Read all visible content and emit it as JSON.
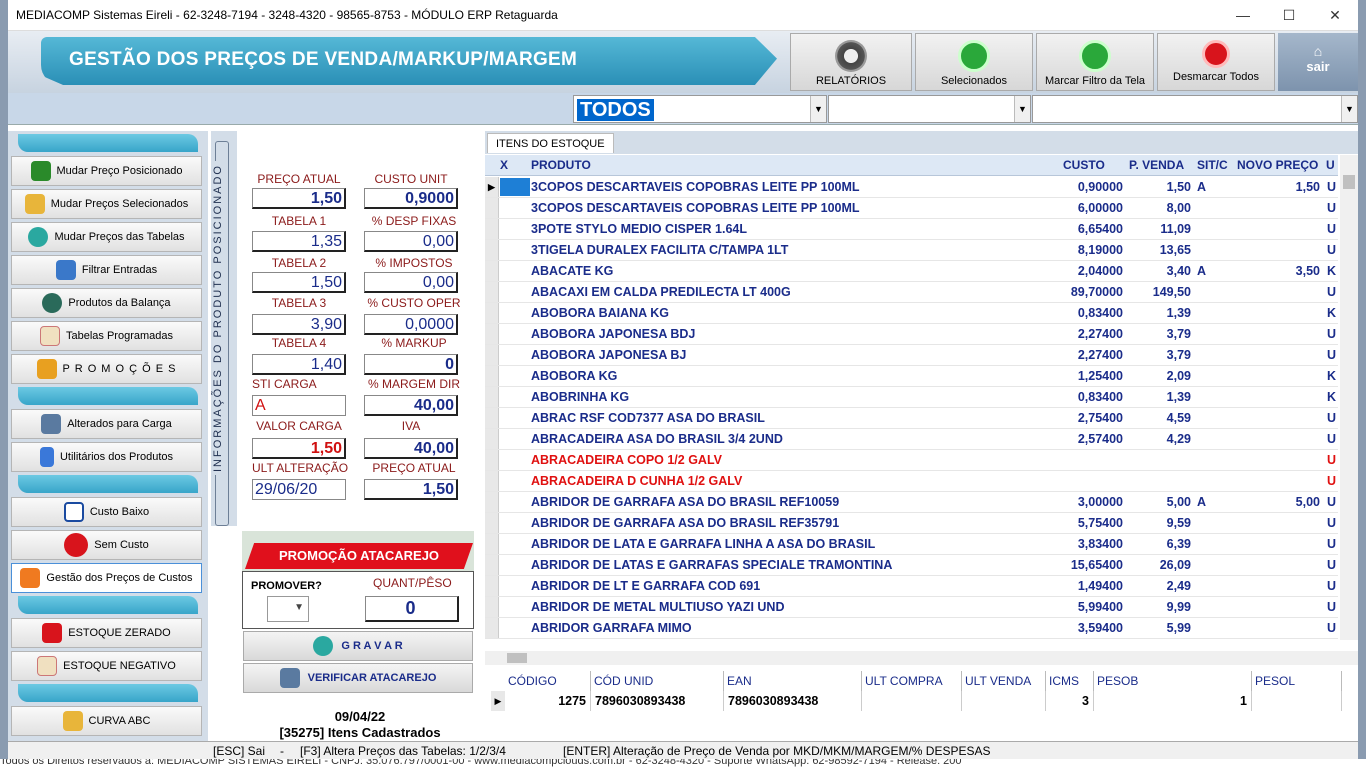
{
  "window_title": "MEDIACOMP Sistemas Eireli - 62-3248-7194 - 3248-4320 - 98565-8753 - MÓDULO ERP Retaguarda",
  "window_controls": {
    "minimize": "—",
    "maximize": "☐",
    "close": "✕"
  },
  "banner_title": "GESTÃO DOS PREÇOS DE VENDA/MARKUP/MARGEM",
  "toolbar": {
    "relatorios": "RELATÓRIOS",
    "selecionados": "Selecionados",
    "marcar": "Marcar Filtro da Tela",
    "desmarcar": "Desmarcar Todos",
    "sair": "sair",
    "sair_icon": "⌂"
  },
  "filter": {
    "todos": "TODOS",
    "arrow": "▼"
  },
  "nav": [
    "Mudar Preço Posicionado",
    "Mudar Preços Selecionados",
    "Mudar Preços das Tabelas",
    "Filtrar Entradas",
    "Produtos da Balança",
    "Tabelas Programadas",
    "P R O M O Ç Õ E S",
    "Alterados para Carga",
    "Utilitários dos Produtos",
    "Custo Baixo",
    "Sem Custo",
    "Gestão dos Preços de Custos",
    "ESTOQUE ZERADO",
    "ESTOQUE NEGATIVO",
    "CURVA ABC"
  ],
  "vertical_label": "INFORMAÇÕES DO PRODUTO POSICIONADO",
  "info": {
    "preco_atual_lbl": "PREÇO ATUAL",
    "preco_atual": "1,50",
    "custo_unit_lbl": "CUSTO UNIT",
    "custo_unit": "0,9000",
    "tabela1_lbl": "TABELA 1",
    "tabela1": "1,35",
    "desp_fixas_lbl": "% DESP FIXAS",
    "desp_fixas": "0,00",
    "tabela2_lbl": "TABELA 2",
    "tabela2": "1,50",
    "impostos_lbl": "% IMPOSTOS",
    "impostos": "0,00",
    "tabela3_lbl": "TABELA 3",
    "tabela3": "3,90",
    "custo_oper_lbl": "% CUSTO OPER",
    "custo_oper": "0,0000",
    "tabela4_lbl": "TABELA 4",
    "tabela4": "1,40",
    "markup_lbl": "% MARKUP",
    "markup": "0",
    "sti_carga_lbl": "STI CARGA",
    "sti_carga": "A",
    "margem_dir_lbl": "% MARGEM DIR",
    "margem_dir": "40,00",
    "valor_carga_lbl": "VALOR CARGA",
    "valor_carga": "1,50",
    "iva_lbl": "IVA",
    "iva": "40,00",
    "ult_alteracao_lbl": "ULT ALTERAÇÃO",
    "ult_alteracao": "29/06/20",
    "preco_atual2_lbl": "PREÇO ATUAL",
    "preco_atual2": "1,50"
  },
  "promo": {
    "title": "PROMOÇÃO ATACAREJO",
    "promover_lbl": "PROMOVER?",
    "quant_lbl": "QUANT/PÊSO",
    "quant": "0",
    "gravar": "G R A V A R",
    "verificar": "VERIFICAR ATACAREJO"
  },
  "summary": {
    "date": "09/04/22",
    "count": "[35275] Itens Cadastrados"
  },
  "grid": {
    "tab": "ITENS DO ESTOQUE",
    "headers": {
      "x": "X",
      "produto": "PRODUTO",
      "custo": "CUSTO",
      "pvenda": "P. VENDA",
      "sitc": "SIT/C",
      "novo": "NOVO PREÇO",
      "u": "U"
    },
    "rows": [
      {
        "produto": "3COPOS DESCARTAVEIS COPOBRAS LEITE  PP 100ML",
        "custo": "0,90000",
        "pvenda": "1,50",
        "sitc": "A",
        "novo": "1,50",
        "u": "U"
      },
      {
        "produto": "3COPOS DESCARTAVEIS COPOBRAS LEITE  PP 100ML",
        "custo": "6,00000",
        "pvenda": "8,00",
        "sitc": "",
        "novo": "",
        "u": "U"
      },
      {
        "produto": "3POTE STYLO MEDIO CISPER 1.64L",
        "custo": "6,65400",
        "pvenda": "11,09",
        "sitc": "",
        "novo": "",
        "u": "U"
      },
      {
        "produto": "3TIGELA DURALEX FACILITA C/TAMPA 1LT",
        "custo": "8,19000",
        "pvenda": "13,65",
        "sitc": "",
        "novo": "",
        "u": "U"
      },
      {
        "produto": "ABACATE KG",
        "custo": "2,04000",
        "pvenda": "3,40",
        "sitc": "A",
        "novo": "3,50",
        "u": "K"
      },
      {
        "produto": "ABACAXI EM CALDA PREDILECTA LT 400G",
        "custo": "89,70000",
        "pvenda": "149,50",
        "sitc": "",
        "novo": "",
        "u": "U"
      },
      {
        "produto": "ABOBORA BAIANA KG",
        "custo": "0,83400",
        "pvenda": "1,39",
        "sitc": "",
        "novo": "",
        "u": "K"
      },
      {
        "produto": "ABOBORA JAPONESA BDJ",
        "custo": "2,27400",
        "pvenda": "3,79",
        "sitc": "",
        "novo": "",
        "u": "U"
      },
      {
        "produto": "ABOBORA JAPONESA BJ",
        "custo": "2,27400",
        "pvenda": "3,79",
        "sitc": "",
        "novo": "",
        "u": "U"
      },
      {
        "produto": "ABOBORA KG",
        "custo": "1,25400",
        "pvenda": "2,09",
        "sitc": "",
        "novo": "",
        "u": "K"
      },
      {
        "produto": "ABOBRINHA KG",
        "custo": "0,83400",
        "pvenda": "1,39",
        "sitc": "",
        "novo": "",
        "u": "K"
      },
      {
        "produto": "ABRAC RSF COD7377 ASA DO BRASIL",
        "custo": "2,75400",
        "pvenda": "4,59",
        "sitc": "",
        "novo": "",
        "u": "U"
      },
      {
        "produto": "ABRACADEIRA ASA DO BRASIL  3/4 2UND",
        "custo": "2,57400",
        "pvenda": "4,29",
        "sitc": "",
        "novo": "",
        "u": "U"
      },
      {
        "produto": "ABRACADEIRA COPO 1/2 GALV",
        "custo": "",
        "pvenda": "",
        "sitc": "",
        "novo": "",
        "u": "U",
        "red": true
      },
      {
        "produto": "ABRACADEIRA D CUNHA 1/2 GALV",
        "custo": "",
        "pvenda": "",
        "sitc": "",
        "novo": "",
        "u": "U",
        "red": true
      },
      {
        "produto": "ABRIDOR DE GARRAFA ASA DO BRASIL REF10059",
        "custo": "3,00000",
        "pvenda": "5,00",
        "sitc": "A",
        "novo": "5,00",
        "u": "U"
      },
      {
        "produto": "ABRIDOR DE GARRAFA ASA DO BRASIL REF35791",
        "custo": "5,75400",
        "pvenda": "9,59",
        "sitc": "",
        "novo": "",
        "u": "U"
      },
      {
        "produto": "ABRIDOR DE LATA E GARRAFA LINHA A ASA DO BRASIL",
        "custo": "3,83400",
        "pvenda": "6,39",
        "sitc": "",
        "novo": "",
        "u": "U"
      },
      {
        "produto": "ABRIDOR DE LATAS E GARRAFAS SPECIALE TRAMONTINA",
        "custo": "15,65400",
        "pvenda": "26,09",
        "sitc": "",
        "novo": "",
        "u": "U"
      },
      {
        "produto": "ABRIDOR DE LT E GARRAFA COD 691",
        "custo": "1,49400",
        "pvenda": "2,49",
        "sitc": "",
        "novo": "",
        "u": "U"
      },
      {
        "produto": "ABRIDOR DE METAL MULTIUSO YAZI UND",
        "custo": "5,99400",
        "pvenda": "9,99",
        "sitc": "",
        "novo": "",
        "u": "U"
      },
      {
        "produto": "ABRIDOR GARRAFA MIMO",
        "custo": "3,59400",
        "pvenda": "5,99",
        "sitc": "",
        "novo": "",
        "u": "U"
      }
    ]
  },
  "detail": {
    "headers": [
      "CÓDIGO",
      "CÓD UNID",
      "EAN",
      "ULT COMPRA",
      "ULT VENDA",
      "ICMS",
      "PESOB",
      "PESOL"
    ],
    "values": [
      "1275",
      "7896030893438",
      "7896030893438",
      "",
      "",
      "3",
      "1",
      ""
    ]
  },
  "status": {
    "esc": "[ESC]  Sai",
    "dash": "-",
    "f3": "[F3] Altera Preços das Tabelas: 1/2/3/4",
    "enter": "[ENTER] Alteração de Preço de Venda por MKD/MKM/MARGEM/% DESPESAS"
  },
  "footer": "Todos os Direitos reservados à: MEDIACOMP SISTEMAS EIRELI - CNPJ: 35.076.797/0001-00 - www.mediacompclouds.com.br - 62-3248-4320 - Suporte WhatsApp: 62-98592-7194 - Release: 200"
}
